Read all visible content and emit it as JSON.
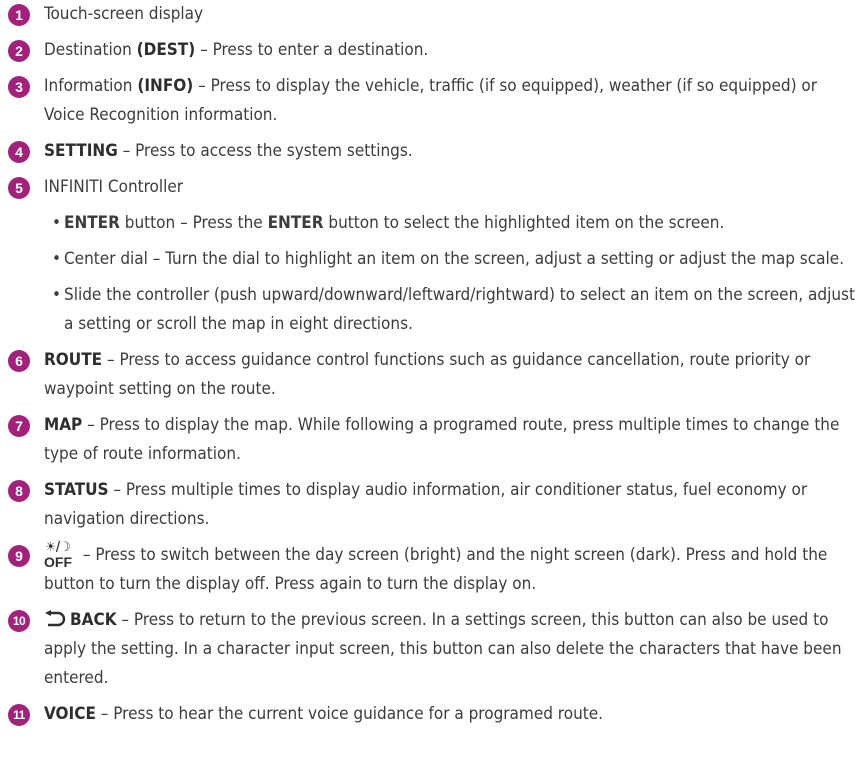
{
  "items": [
    {
      "num": "1",
      "pre": "Touch-screen display",
      "bold": "",
      "post": ""
    },
    {
      "num": "2",
      "pre": "Destination ",
      "bold": "(DEST)",
      "post": " – Press to enter a destination."
    },
    {
      "num": "3",
      "pre": "Information ",
      "bold": "(INFO)",
      "post": " – Press to display the vehicle, traffic (if so equipped), weather (if so equipped) or Voice Recognition information."
    },
    {
      "num": "4",
      "pre": "",
      "bold": "SETTING",
      "post": " – Press to access the system settings."
    },
    {
      "num": "5",
      "pre": "INFINITI Controller",
      "bold": "",
      "post": ""
    },
    {
      "num": "6",
      "pre": "",
      "bold": "ROUTE",
      "post": " – Press to access guidance control functions such as guidance cancellation, route priority or waypoint setting on the route."
    },
    {
      "num": "7",
      "pre": "",
      "bold": "MAP",
      "post": " – Press to display the map. While following a programed route, press multiple times to change the type of route information."
    },
    {
      "num": "8",
      "pre": "",
      "bold": "STATUS",
      "post": " – Press multiple times to display audio information, air conditioner status, fuel economy or navigation directions."
    },
    {
      "num": "9",
      "icon_label": "OFF",
      "post": " – Press to switch between the day screen (bright) and the night screen (dark). Press and hold the button to turn the display off. Press again to turn the display on."
    },
    {
      "num": "10",
      "bold": "BACK",
      "post": " – Press to return to the previous screen. In a settings screen, this button can also be used to apply the setting. In a character input screen, this button can also delete the characters that have been entered."
    },
    {
      "num": "11",
      "bold": "VOICE",
      "post": " – Press to hear the current voice guidance for a programed route."
    }
  ],
  "controller_bullets": [
    {
      "bullet": "•",
      "bold1": "ENTER",
      "mid": " button – Press the ",
      "bold2": "ENTER",
      "post": " button to select the highlighted item on the screen."
    },
    {
      "bullet": "•",
      "text": "Center dial – Turn the dial to highlight an item on the screen, adjust a setting or adjust the map scale."
    },
    {
      "bullet": "•",
      "text": "Slide the controller (push upward/downward/leftward/rightward) to select an item on the screen, adjust a setting or scroll the map in eight directions."
    }
  ],
  "colors": {
    "badge": "#a3207c",
    "text": "#3c3c3c"
  },
  "icons": {
    "day_night": "day-night-off-icon",
    "back": "back-arrow-icon"
  }
}
